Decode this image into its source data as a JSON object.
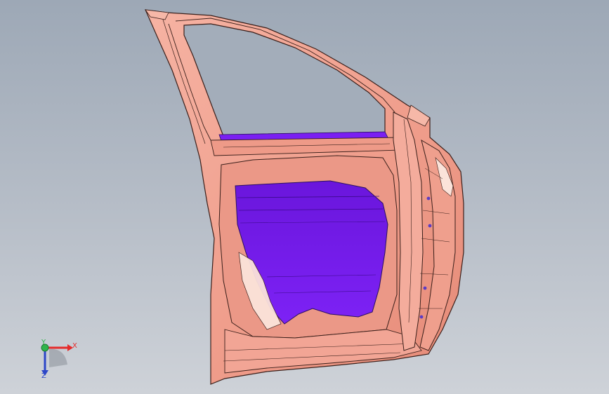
{
  "viewport": {
    "colors": {
      "panel_outer": "#f1a392",
      "panel_inner": "#e8907e",
      "panel_edge": "#3a1f1a",
      "panel_highlight": "#fbe3da",
      "glass_fill": "#7a1ff2",
      "glass_dark": "#5a12c4",
      "hole_marker": "#5b3cc4"
    }
  },
  "triad": {
    "x_label": "X",
    "y_label": "Y",
    "z_label": "Z",
    "colors": {
      "x": "#e52b2b",
      "y": "#2fb44a",
      "z": "#2c46c8"
    }
  }
}
